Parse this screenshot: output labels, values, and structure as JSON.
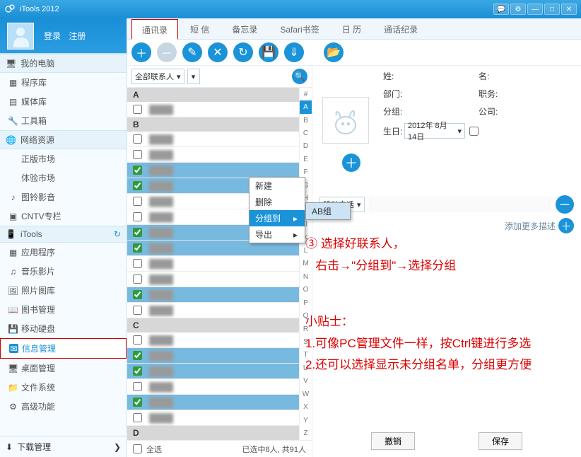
{
  "title": "iTools 2012",
  "login": {
    "login": "登录",
    "register": "注册"
  },
  "nav": {
    "sections": [
      {
        "label": "我的电脑",
        "items": [
          {
            "label": "程序库",
            "icon": "apps"
          },
          {
            "label": "媒体库",
            "icon": "media"
          },
          {
            "label": "工具箱",
            "icon": "tools"
          }
        ]
      },
      {
        "label": "网络资源",
        "items": [
          {
            "label": "正版市场",
            "icon": "apple"
          },
          {
            "label": "体验市场",
            "icon": "apple"
          },
          {
            "label": "图铃影音",
            "icon": "ring"
          },
          {
            "label": "CNTV专栏",
            "icon": "tv"
          }
        ]
      },
      {
        "label": "iTools",
        "refresh": true,
        "items": [
          {
            "label": "应用程序",
            "icon": "apps"
          },
          {
            "label": "音乐影片",
            "icon": "music"
          },
          {
            "label": "照片图库",
            "icon": "photo"
          },
          {
            "label": "图书管理",
            "icon": "book"
          },
          {
            "label": "移动硬盘",
            "icon": "disk"
          },
          {
            "label": "信息管理",
            "icon": "info",
            "active": true
          },
          {
            "label": "桌面管理",
            "icon": "desktop"
          },
          {
            "label": "文件系统",
            "icon": "folder"
          },
          {
            "label": "高级功能",
            "icon": "gear"
          }
        ]
      }
    ],
    "download": "下载管理"
  },
  "tabs": [
    "通讯录",
    "短  信",
    "备忘录",
    "Safari书签",
    "日  历",
    "通话纪录"
  ],
  "active_tab": 0,
  "toolbar": [
    "add",
    "remove",
    "edit",
    "delete",
    "refresh",
    "save",
    "import",
    "spacer",
    "folder"
  ],
  "filter": {
    "label": "全部联系人"
  },
  "index": [
    "#",
    "A",
    "B",
    "C",
    "D",
    "E",
    "F",
    "G",
    "H",
    "I",
    "J",
    "K",
    "L",
    "M",
    "N",
    "O",
    "P",
    "Q",
    "R",
    "S",
    "T",
    "U",
    "V",
    "W",
    "X",
    "Y",
    "Z"
  ],
  "index_active": "A",
  "sections_list": [
    {
      "hdr": "A",
      "rows": [
        {
          "sel": false,
          "chk": false
        }
      ]
    },
    {
      "hdr": "B",
      "rows": [
        {
          "sel": false,
          "chk": false
        },
        {
          "sel": false,
          "chk": false
        },
        {
          "sel": true,
          "chk": true
        },
        {
          "sel": true,
          "chk": true
        },
        {
          "sel": false,
          "chk": false
        },
        {
          "sel": false,
          "chk": false
        },
        {
          "sel": true,
          "chk": true
        },
        {
          "sel": true,
          "chk": true
        },
        {
          "sel": false,
          "chk": false
        },
        {
          "sel": false,
          "chk": false
        },
        {
          "sel": true,
          "chk": true
        },
        {
          "sel": false,
          "chk": false
        }
      ]
    },
    {
      "hdr": "C",
      "rows": [
        {
          "sel": false,
          "chk": false
        },
        {
          "sel": true,
          "chk": true
        },
        {
          "sel": true,
          "chk": true
        },
        {
          "sel": false,
          "chk": false
        },
        {
          "sel": true,
          "chk": true
        },
        {
          "sel": false,
          "chk": false
        }
      ]
    },
    {
      "hdr": "D",
      "rows": []
    }
  ],
  "footer": {
    "select_all": "全选",
    "count": "已选中8人, 共91人"
  },
  "detail": {
    "labels": {
      "lastname": "姓:",
      "firstname": "名:",
      "dept": "部门:",
      "title": "职务:",
      "group": "分组:",
      "company": "公司:",
      "birthday": "生日:"
    },
    "birthday_value": "2012年 8月14日",
    "phone_type": "移动电话",
    "add_more": "添加更多描述",
    "cancel": "撤销",
    "save": "保存"
  },
  "context": {
    "new": "新建",
    "delete": "删除",
    "group_to": "分组到",
    "export": "导出"
  },
  "sub": {
    "ab": "AB组"
  },
  "anno": {
    "step": "③ 选择好联系人，",
    "step2": "右击→\"分组到\"→选择分组",
    "tips_title": "小贴士：",
    "tip1": "1.可像PC管理文件一样，按Ctrl键进行多选",
    "tip2": "2.还可以选择显示未分组名单，分组更方便"
  }
}
